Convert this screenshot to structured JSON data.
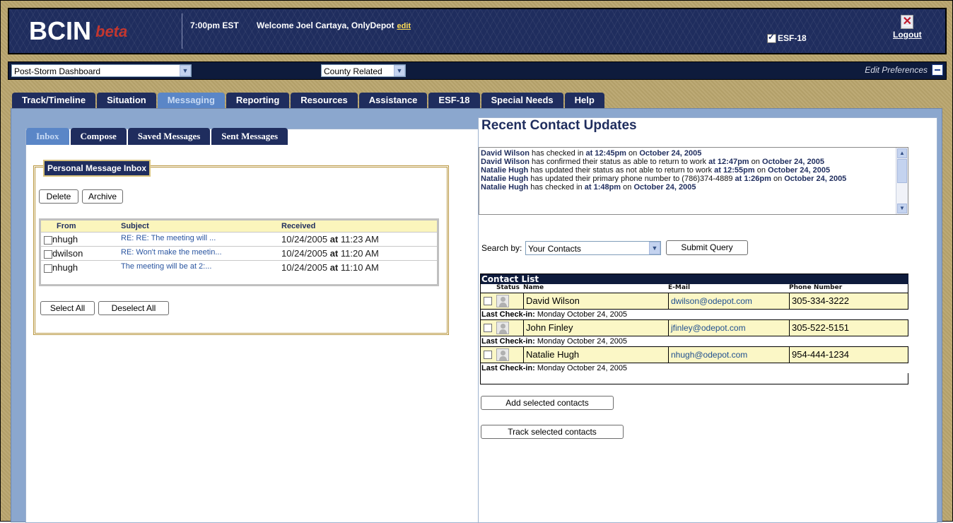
{
  "header": {
    "logo": "BCIN",
    "logo_badge": "beta",
    "time": "7:00pm EST",
    "welcome": "Welcome Joel Cartaya, OnlyDepot",
    "edit_label": "edit",
    "esf_label": "ESF-18",
    "logout_label": "Logout"
  },
  "dashbar": {
    "dashboard_select": "Post-Storm Dashboard",
    "county_select": "County Related",
    "edit_preferences": "Edit Preferences"
  },
  "main_tabs": [
    "Track/Timeline",
    "Situation",
    "Messaging",
    "Reporting",
    "Resources",
    "Assistance",
    "ESF-18",
    "Special Needs",
    "Help"
  ],
  "main_tab_active": "Messaging",
  "inbox": {
    "subtabs": [
      "Inbox",
      "Compose",
      "Saved Messages",
      "Sent Messages"
    ],
    "legend": "Personal Message Inbox",
    "delete_label": "Delete",
    "archive_label": "Archive",
    "columns": {
      "from": "From",
      "subject": "Subject",
      "received": "Received"
    },
    "at_word": "at",
    "messages": [
      {
        "from": "nhugh",
        "subject": "RE: RE: The meeting will ...",
        "date": "10/24/2005",
        "time": "11:23 AM"
      },
      {
        "from": "dwilson",
        "subject": "RE: Won't make the meetin...",
        "date": "10/24/2005",
        "time": "11:20 AM"
      },
      {
        "from": "nhugh",
        "subject": "The meeting will be at 2:...",
        "date": "10/24/2005",
        "time": "11:10 AM"
      }
    ],
    "select_all_label": "Select All",
    "deselect_all_label": "Deselect All"
  },
  "recent": {
    "title": "Recent Contact Updates",
    "updates": [
      {
        "name": "David Wilson",
        "text": " has checked in ",
        "at": "at 12:45pm",
        "on": " on ",
        "date": "October 24, 2005"
      },
      {
        "name": "David Wilson",
        "text": " has confirmed their status as able to return to work ",
        "at": "at 12:47pm",
        "on": " on ",
        "date": "October 24, 2005"
      },
      {
        "name": "Natalie Hugh",
        "text": " has updated their status as not able to return to work ",
        "at": "at 12:55pm",
        "on": " on ",
        "date": "October 24, 2005"
      },
      {
        "name": "Natalie Hugh",
        "text": " has updated their primary phone number to (786)374-4889 ",
        "at": "at 1:26pm",
        "on": " on ",
        "date": "October 24, 2005"
      },
      {
        "name": "Natalie Hugh",
        "text": " has checked in ",
        "at": "at 1:48pm",
        "on": " on ",
        "date": "October 24, 2005"
      }
    ]
  },
  "search": {
    "label": "Search by:",
    "select_value": "Your Contacts",
    "submit_label": "Submit Query"
  },
  "contacts": {
    "title": "Contact List",
    "columns": {
      "status": "Status",
      "name": "Name",
      "email": "E-Mail",
      "phone": "Phone Number"
    },
    "last_checkin_label": "Last Check-in:",
    "rows": [
      {
        "name": "David Wilson",
        "email": "dwilson@odepot.com",
        "phone": "305-334-3222",
        "last_checkin": "Monday October 24, 2005"
      },
      {
        "name": "John Finley",
        "email": "jfinley@odepot.com",
        "phone": "305-522-5151",
        "last_checkin": "Monday October 24, 2005"
      },
      {
        "name": "Natalie Hugh",
        "email": "nhugh@odepot.com",
        "phone": "954-444-1234",
        "last_checkin": "Monday October 24, 2005"
      }
    ],
    "add_label": "Add selected contacts",
    "track_label": "Track selected contacts"
  }
}
